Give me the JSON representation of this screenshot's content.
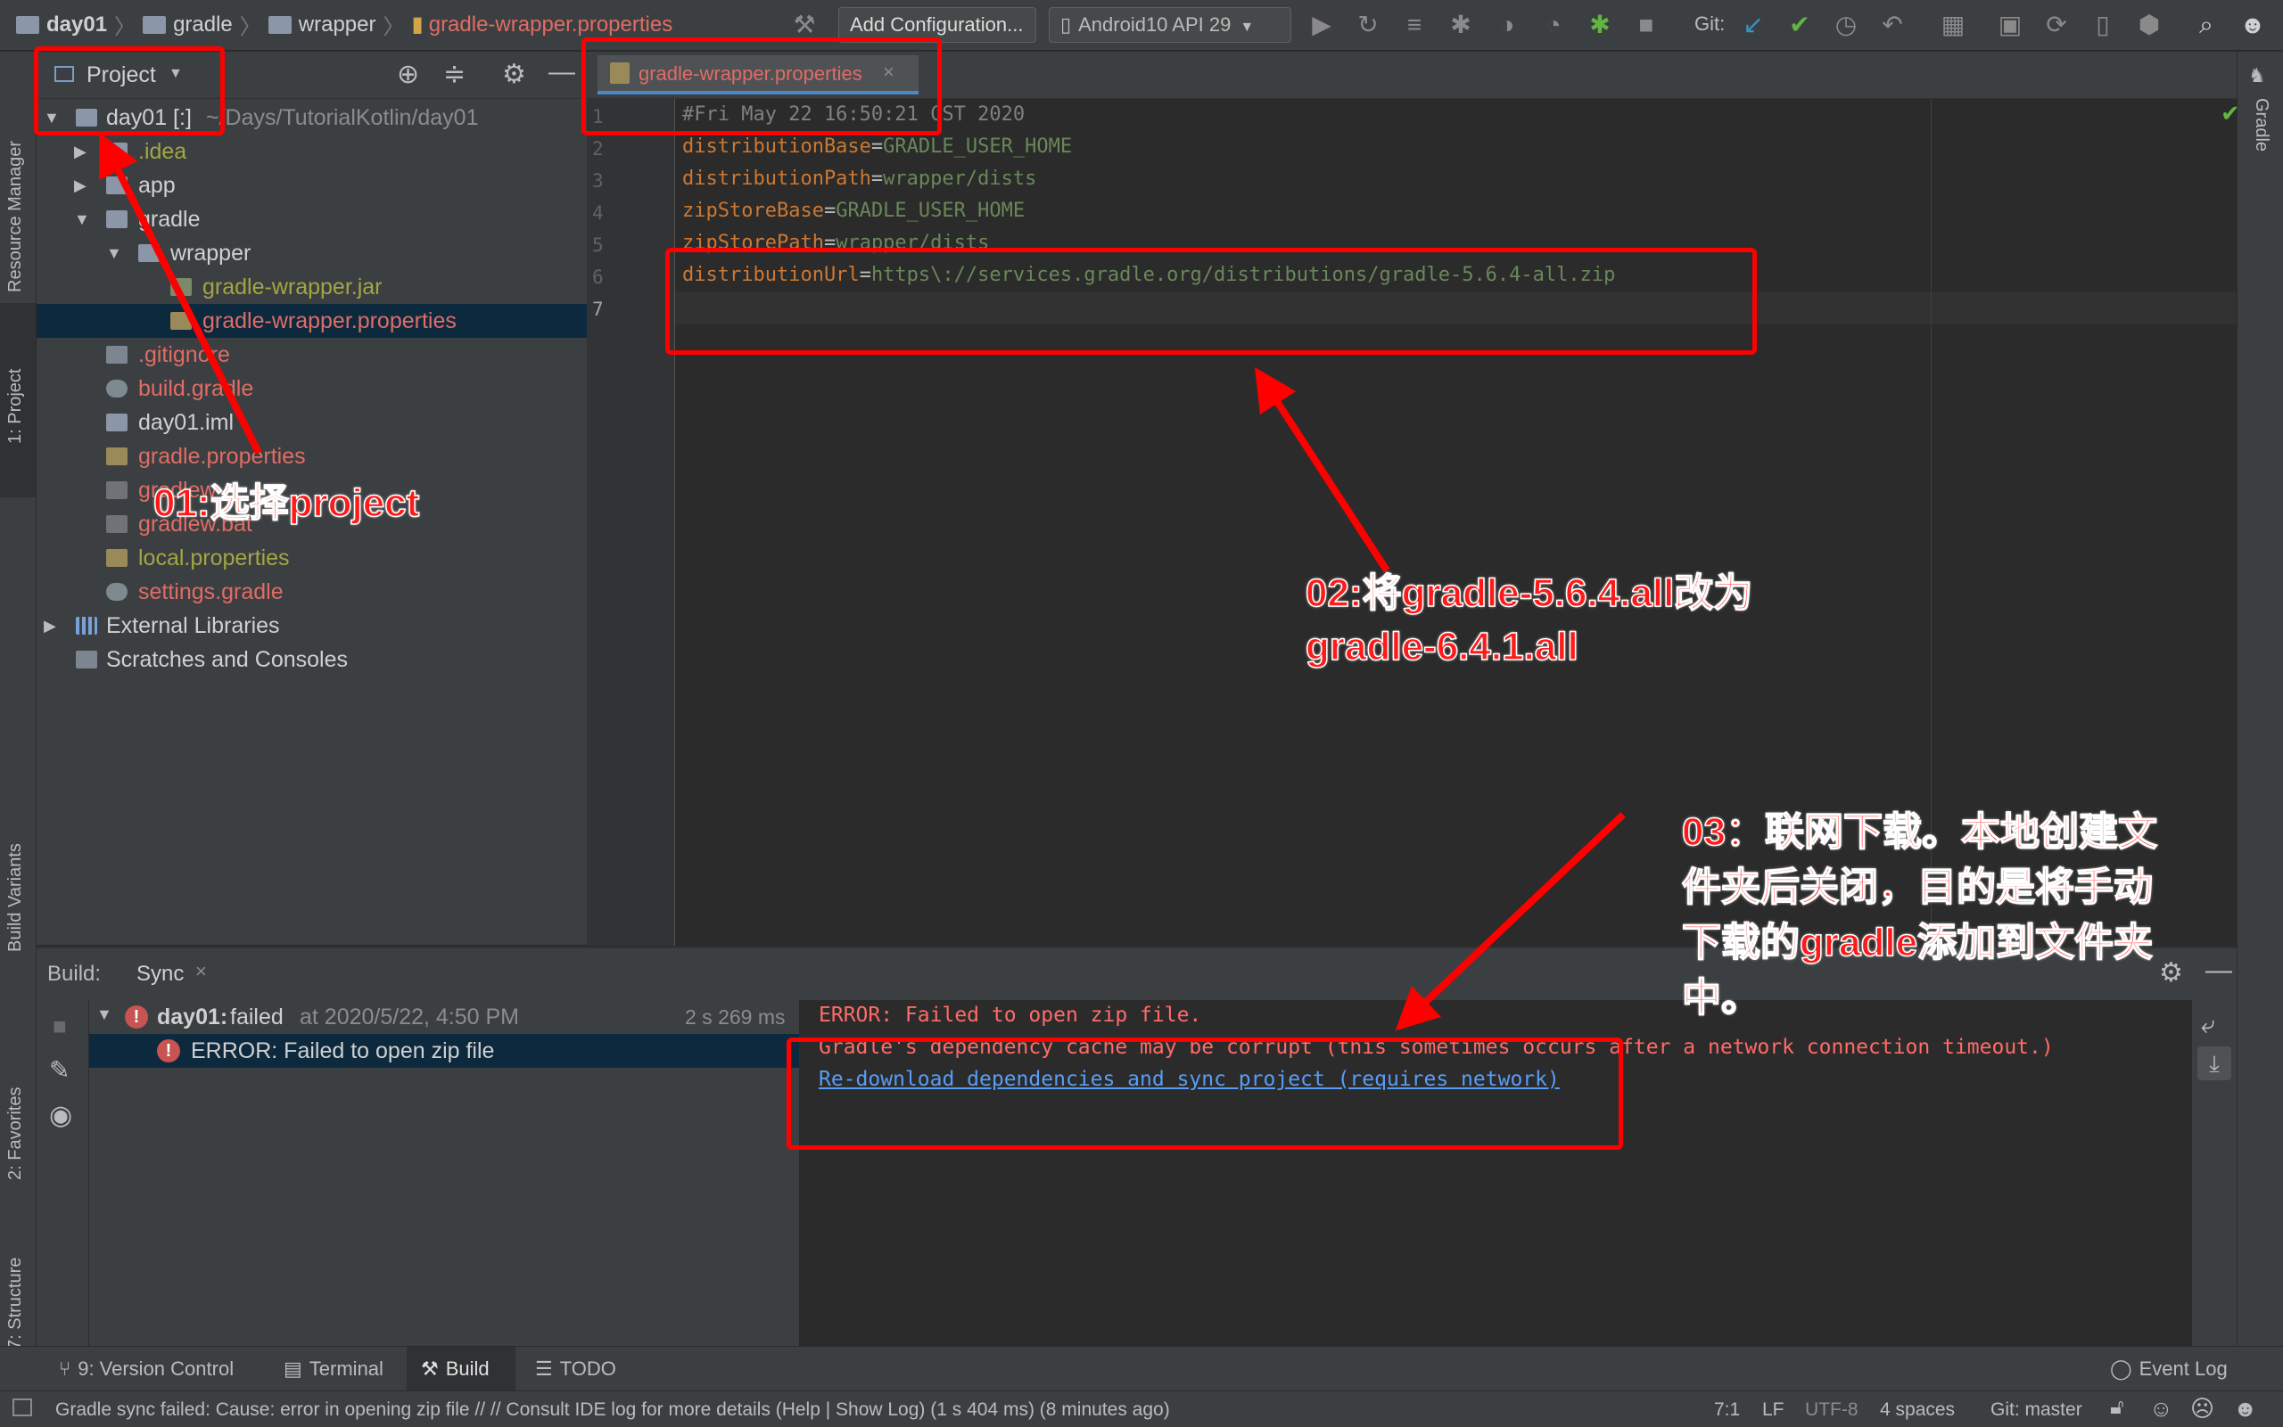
{
  "breadcrumb": [
    "day01",
    "gradle",
    "wrapper",
    "gradle-wrapper.properties"
  ],
  "toolbar": {
    "add_configuration": "Add Configuration...",
    "device": "Android10 API 29",
    "git_label": "Git:"
  },
  "left_stripe": [
    "Resource Manager",
    "1: Project",
    "Build Variants",
    "2: Favorites",
    "7: Structure"
  ],
  "right_stripe": [
    "Gradle"
  ],
  "project": {
    "header": "Project",
    "tree": [
      {
        "label": "day01 [:]",
        "path": "~/Days/TutorialKotlin/day01"
      },
      {
        "label": ".idea"
      },
      {
        "label": "app"
      },
      {
        "label": "gradle"
      },
      {
        "label": "wrapper"
      },
      {
        "label": "gradle-wrapper.jar"
      },
      {
        "label": "gradle-wrapper.properties"
      },
      {
        "label": ".gitignore"
      },
      {
        "label": "build.gradle"
      },
      {
        "label": "day01.iml"
      },
      {
        "label": "gradle.properties"
      },
      {
        "label": "gradlew"
      },
      {
        "label": "gradlew.bat"
      },
      {
        "label": "local.properties"
      },
      {
        "label": "settings.gradle"
      },
      {
        "label": "External Libraries"
      },
      {
        "label": "Scratches and Consoles"
      }
    ]
  },
  "editor": {
    "tab": "gradle-wrapper.properties",
    "line_numbers": [
      "1",
      "2",
      "3",
      "4",
      "5",
      "6",
      "7"
    ],
    "lines": [
      {
        "comment": "#Fri May 22 16:50:21 CST 2020"
      },
      {
        "key": "distributionBase",
        "value": "GRADLE_USER_HOME"
      },
      {
        "key": "distributionPath",
        "value": "wrapper/dists"
      },
      {
        "key": "zipStoreBase",
        "value": "GRADLE_USER_HOME"
      },
      {
        "key": "zipStorePath",
        "value": "wrapper/dists"
      },
      {
        "key": "distributionUrl",
        "value": "https\\://services.gradle.org/distributions/gradle-5.6.4-all.zip"
      }
    ]
  },
  "build": {
    "label": "Build:",
    "tab": "Sync",
    "root": {
      "name": "day01:",
      "status": "failed",
      "time_text": "at 2020/5/22, 4:50 PM",
      "duration": "2 s 269 ms"
    },
    "child": "ERROR: Failed to open zip file",
    "console": [
      "ERROR: Failed to open zip file.",
      "Gradle's dependency cache may be corrupt (this sometimes occurs after a network connection timeout.)",
      "Re-download dependencies and sync project (requires network)"
    ]
  },
  "toolwindows": [
    "9: Version Control",
    "Terminal",
    "Build",
    "TODO"
  ],
  "event_log": "Event Log",
  "status": {
    "message": "Gradle sync failed: Cause: error in opening zip file // // Consult IDE log for more details (Help | Show Log) (1 s 404 ms) (8 minutes ago)",
    "position": "7:1",
    "line_sep": "LF",
    "encoding": "UTF-8",
    "indent": "4 spaces",
    "branch": "Git: master"
  },
  "annotations": {
    "note1": "01:选择project",
    "note2_line1": "02:将gradle-5.6.4.all改为",
    "note2_line2": "gradle-6.4.1.all",
    "note3_line1": "03：联网下载。本地创建文",
    "note3_line2": "件夹后关闭，目的是将手动",
    "note3_line3": "下载的gradle添加到文件夹",
    "note3_line4": "中。"
  },
  "colors": {
    "error": "#ff6b68",
    "link": "#589df6",
    "annotation": "#ff0000",
    "modified_file": "#e06c65",
    "added_file": "#a3a642"
  }
}
